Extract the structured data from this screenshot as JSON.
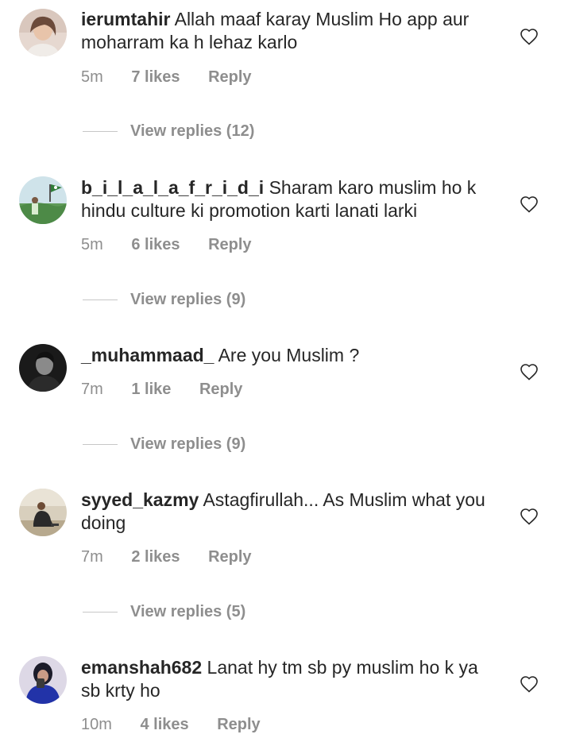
{
  "comments": [
    {
      "username": "ierumtahir",
      "text": "Allah maaf karay Muslim Ho app aur moharram ka h lehaz karlo",
      "time": "5m",
      "likes": "7 likes",
      "reply": "Reply",
      "view_replies": "View replies (12)"
    },
    {
      "username": "b_i_l_a_l_a_f_r_i_d_i",
      "text": "Sharam karo muslim ho k hindu culture ki promotion karti lanati larki",
      "time": "5m",
      "likes": "6 likes",
      "reply": "Reply",
      "view_replies": "View replies (9)"
    },
    {
      "username": "_muhammaad_",
      "text": "Are you Muslim ?",
      "time": "7m",
      "likes": "1 like",
      "reply": "Reply",
      "view_replies": "View replies (9)"
    },
    {
      "username": "syyed_kazmy",
      "text": "Astagfirullah... As Muslim what you doing",
      "time": "7m",
      "likes": "2 likes",
      "reply": "Reply",
      "view_replies": "View replies (5)"
    },
    {
      "username": "emanshah682",
      "text": "Lanat hy tm sb py muslim ho k ya sb krty ho",
      "time": "10m",
      "likes": "4 likes",
      "reply": "Reply"
    }
  ],
  "icons": {
    "like": "heart-outline-icon"
  },
  "colors": {
    "text": "#262626",
    "secondary": "#8e8e8e",
    "divider": "#c7c7c7"
  }
}
